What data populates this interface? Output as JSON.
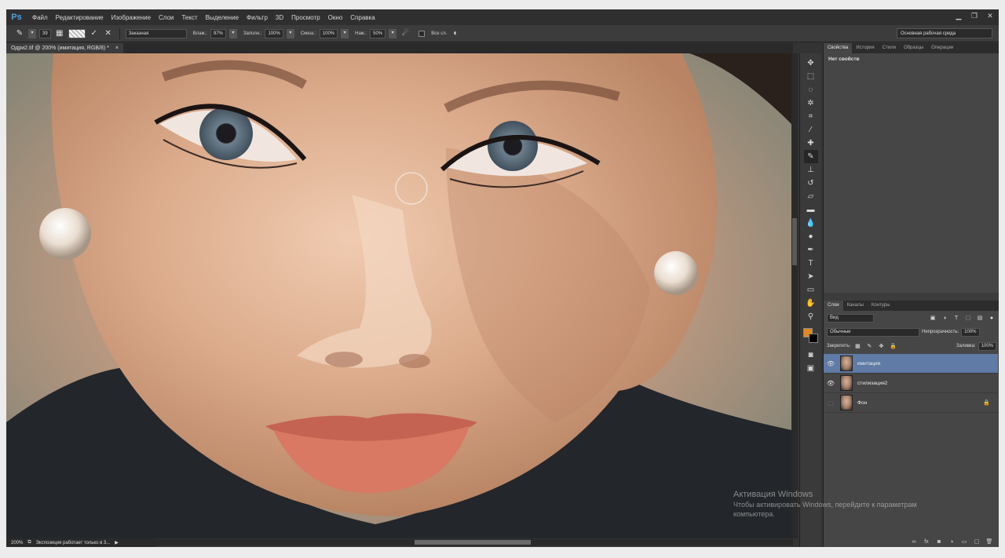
{
  "app": {
    "logo": "Ps",
    "menu": [
      "Файл",
      "Редактирование",
      "Изображение",
      "Слои",
      "Текст",
      "Выделение",
      "Фильтр",
      "3D",
      "Просмотр",
      "Окно",
      "Справка"
    ]
  },
  "options": {
    "brush_size": "39",
    "preset": "Заказная",
    "wet_label": "Влаж.:",
    "wet_value": "97%",
    "load_label": "Заполн.:",
    "load_value": "100%",
    "mix_label": "Смеш.:",
    "mix_value": "100%",
    "flow_label": "Наж.:",
    "flow_value": "50%",
    "all_layers_label": "Все сл.",
    "workspace": "Основная рабочая среда"
  },
  "document": {
    "tab_title": "Одри2.tif @ 200% (имитация, RGB/8) *",
    "close_glyph": "×",
    "zoom": "200%",
    "status": "Экспозиция работает только в 3..."
  },
  "properties": {
    "tabs": [
      "Свойства",
      "История",
      "Стили",
      "Образцы",
      "Операции"
    ],
    "empty_text": "Нет свойств"
  },
  "layers": {
    "tabs": [
      "Слои",
      "Каналы",
      "Контуры"
    ],
    "filter": "Вид",
    "blend_mode": "Обычные",
    "opacity_label": "Непрозрачность:",
    "opacity_value": "100%",
    "lock_label": "Закрепить:",
    "fill_label": "Заливка:",
    "fill_value": "100%",
    "items": [
      {
        "name": "имитация",
        "selected": true
      },
      {
        "name": "стилизация2",
        "selected": false
      },
      {
        "name": "Фон",
        "selected": false
      }
    ]
  },
  "watermark": {
    "title": "Активация Windows",
    "subtitle": "Чтобы активировать Windows, перейдите к параметрам",
    "sub2": "компьютера."
  },
  "colors": {
    "foreground": "#e5881d",
    "background": "#000000",
    "selection": "#5f7ba6"
  }
}
